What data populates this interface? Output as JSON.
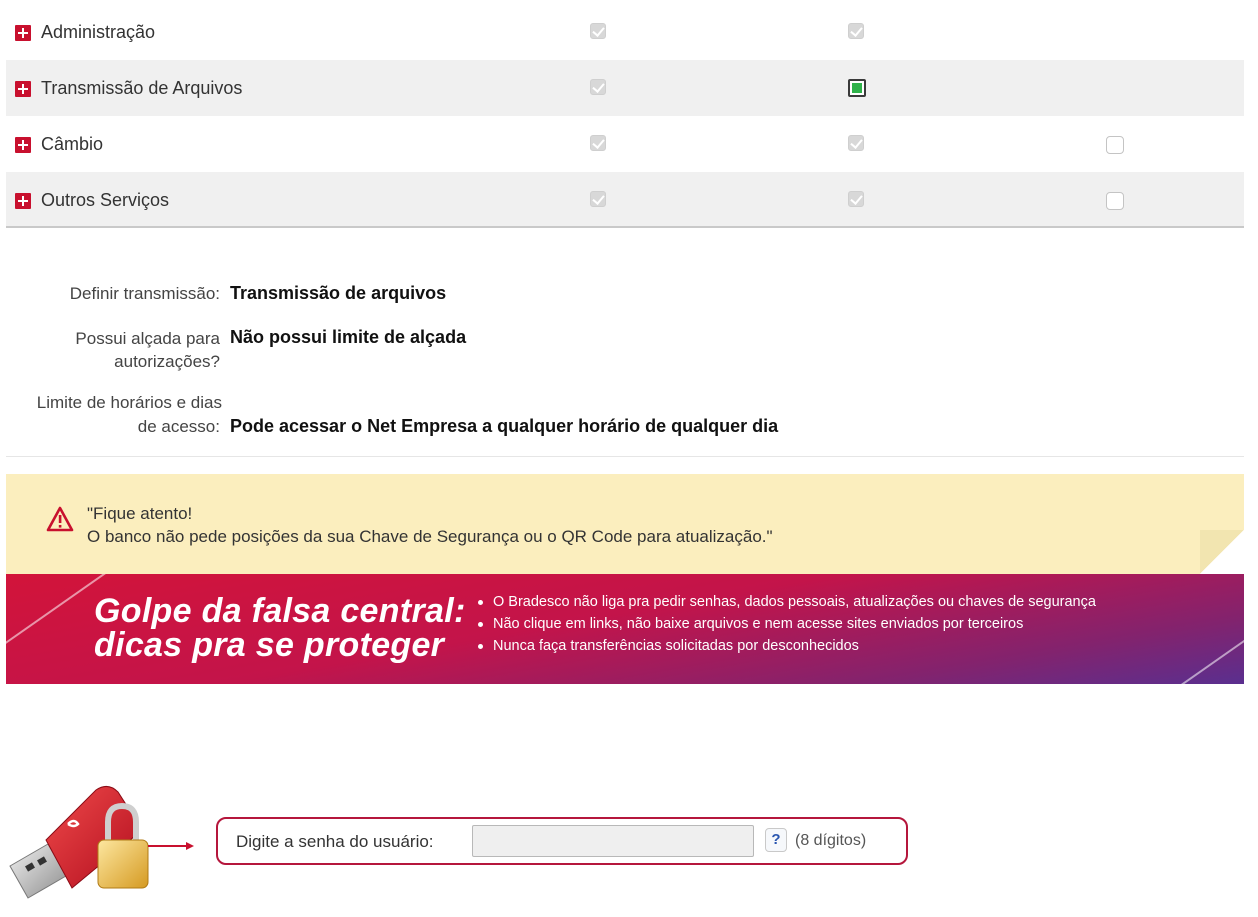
{
  "permissions": {
    "rows": [
      {
        "label": "Administração"
      },
      {
        "label": "Transmissão de Arquivos"
      },
      {
        "label": "Câmbio"
      },
      {
        "label": "Outros Serviços"
      }
    ]
  },
  "details": {
    "transmission_key": "Definir transmissão:",
    "transmission_value": "Transmissão de arquivos",
    "authority_key_line1": "Possui alçada para",
    "authority_key_line2": "autorizações?",
    "authority_value": "Não possui limite de alçada",
    "access_key_line1": "Limite de horários e dias",
    "access_key_line2": "de acesso:",
    "access_value": "Pode acessar o Net Empresa a qualquer horário de qualquer dia"
  },
  "warning": {
    "line1": "\"Fique atento!",
    "line2": "O banco não pede posições da sua Chave de Segurança ou o QR Code para atualização.\""
  },
  "banner": {
    "title_line1": "Golpe da falsa central:",
    "title_line2": "dicas pra se proteger",
    "tips": [
      "O Bradesco não liga pra pedir senhas, dados pessoais, atualizações ou chaves de segurança",
      "Não clique em links, não baixe arquivos e nem acesse sites enviados por terceiros",
      "Nunca faça transferências solicitadas por desconhecidos"
    ]
  },
  "password": {
    "label": "Digite a senha do usuário:",
    "value": "",
    "help": "?",
    "hint": "(8 dígitos)"
  },
  "colors": {
    "brand_red": "#c8102e",
    "warning_bg": "#fbeebe",
    "checkbox_active": "#2fb24a"
  }
}
